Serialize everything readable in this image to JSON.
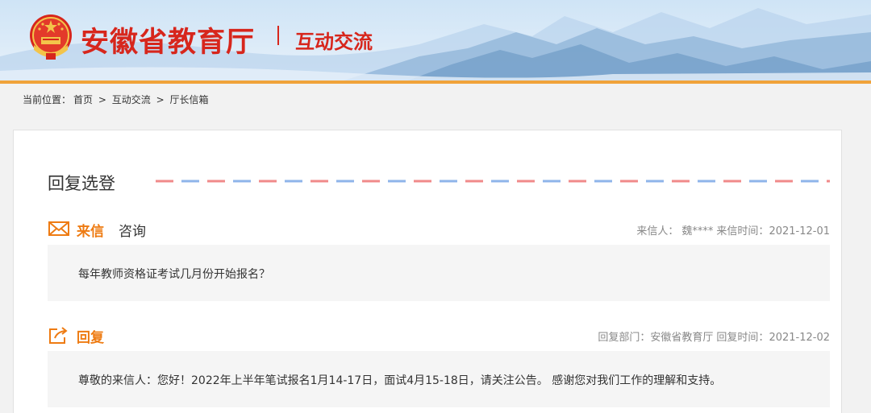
{
  "header": {
    "site_name": "安徽省教育厅",
    "section_name": "互动交流"
  },
  "breadcrumb": {
    "prefix": "当前位置：",
    "items": [
      "首页",
      "互动交流",
      "厅长信箱"
    ],
    "separator": ">"
  },
  "card": {
    "title": "回复选登"
  },
  "letter": {
    "tag": "来信",
    "subject": "咨询",
    "sender_label": "来信人：",
    "sender": "魏****",
    "date_label": "来信时间：",
    "date": "2021-12-01",
    "content": "每年教师资格证考试几月份开始报名？"
  },
  "reply": {
    "tag": "回复",
    "dept_label": "回复部门：",
    "dept": "安徽省教育厅",
    "date_label": "回复时间：",
    "date": "2021-12-02",
    "content": "尊敬的来信人：您好！2022年上半年笔试报名1月14-17日，面试4月15-18日，请关注公告。 感谢您对我们工作的理解和支持。"
  },
  "colors": {
    "brand_red": "#d7261c",
    "accent_orange": "#ee7b12",
    "header_bar": "#f0a33a",
    "dash_red": "#f08a8a",
    "dash_blue": "#8fb4ea"
  },
  "icons": [
    "national-emblem-icon",
    "envelope-icon",
    "reply-share-icon"
  ]
}
